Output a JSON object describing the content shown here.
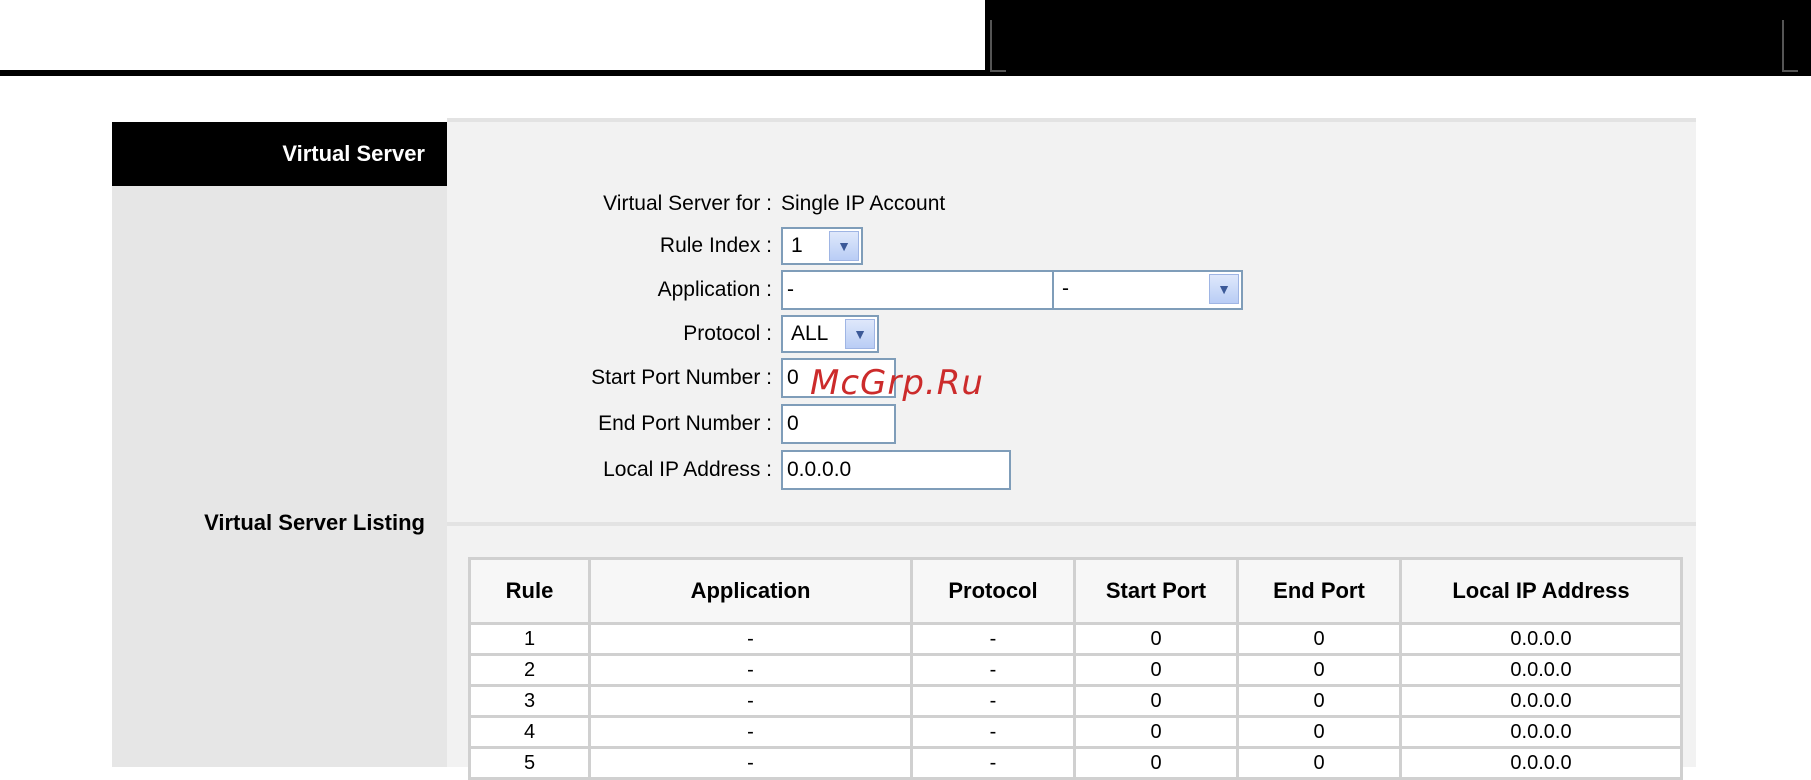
{
  "sidebar": {
    "title": "Virtual Server",
    "listing_label": "Virtual Server Listing"
  },
  "form": {
    "virtual_server_for_label": "Virtual Server for :",
    "virtual_server_for_value": "Single IP Account",
    "rule_index_label": "Rule Index :",
    "rule_index_value": "1",
    "application_label": "Application :",
    "application_value": "-",
    "application_select_value": "-",
    "protocol_label": "Protocol :",
    "protocol_value": "ALL",
    "start_port_label": "Start Port Number :",
    "start_port_value": "0",
    "end_port_label": "End Port Number :",
    "end_port_value": "0",
    "local_ip_label": "Local IP Address :",
    "local_ip_value": "0.0.0.0"
  },
  "watermark": "McGrp.Ru",
  "table": {
    "headers": [
      "Rule",
      "Application",
      "Protocol",
      "Start Port",
      "End Port",
      "Local IP Address"
    ],
    "rows": [
      [
        "1",
        "-",
        "-",
        "0",
        "0",
        "0.0.0.0"
      ],
      [
        "2",
        "-",
        "-",
        "0",
        "0",
        "0.0.0.0"
      ],
      [
        "3",
        "-",
        "-",
        "0",
        "0",
        "0.0.0.0"
      ],
      [
        "4",
        "-",
        "-",
        "0",
        "0",
        "0.0.0.0"
      ],
      [
        "5",
        "-",
        "-",
        "0",
        "0",
        "0.0.0.0"
      ]
    ]
  },
  "colors": {
    "header_black": "#000000",
    "side_gray": "#e6e6e6",
    "input_border": "#7f9db9",
    "watermark_red": "#cc2b2b"
  },
  "icons": {
    "dropdown": "chevron-down-icon"
  }
}
